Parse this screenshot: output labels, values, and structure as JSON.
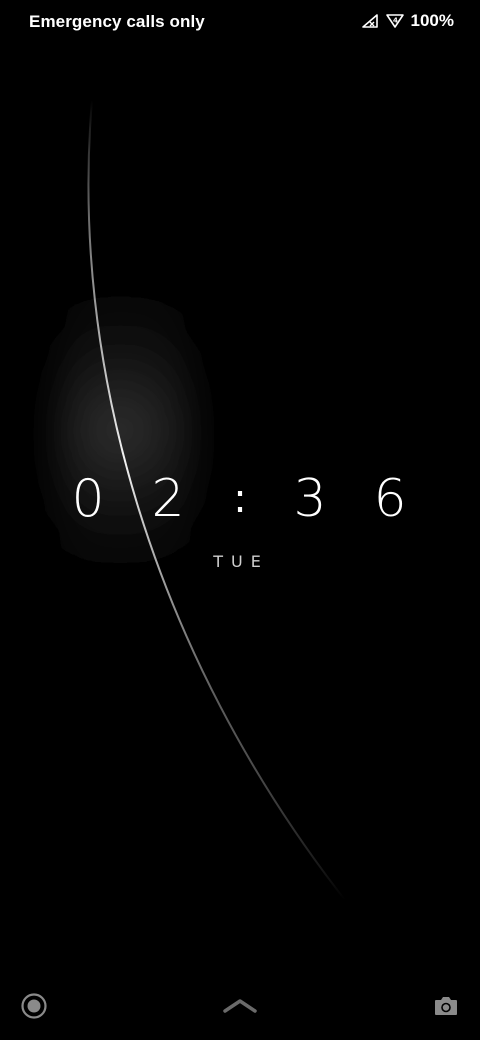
{
  "status_bar": {
    "carrier_text": "Emergency calls only",
    "battery_text": "100%",
    "icons": [
      "no-sim-icon",
      "signal-4g-icon"
    ]
  },
  "clock": {
    "hour_tens": "0",
    "hour_ones": "2",
    "separator": ":",
    "minute_tens": "3",
    "minute_ones": "6",
    "weekday": "TUE"
  },
  "bottom_bar": {
    "left_icon": "assistant-icon",
    "center_icon": "swipe-up-icon",
    "right_icon": "camera-icon"
  },
  "colors": {
    "background": "#000000",
    "text": "#ffffff",
    "icon_gray": "#8a8a8a"
  }
}
